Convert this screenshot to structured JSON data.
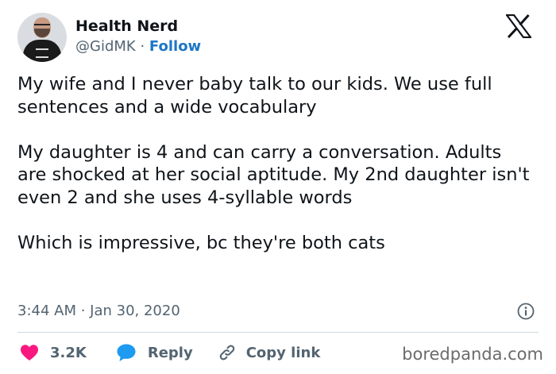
{
  "author": {
    "name": "Health Nerd",
    "handle": "@GidMK",
    "separator": "·",
    "follow_label": "Follow"
  },
  "tweet": {
    "text": "My wife and I never baby talk to our kids. We use full sentences and a wide vocabulary\n\nMy daughter is 4 and can carry a conversation. Adults are shocked at her social aptitude. My 2nd daughter isn't even 2 and she uses 4-syllable words\n\nWhich is impressive, bc they're both cats",
    "time": "3:44 AM · Jan 30, 2020"
  },
  "actions": {
    "like_count": "3.2K",
    "reply_label": "Reply",
    "copy_label": "Copy link"
  },
  "watermark": "boredpanda.com",
  "icons": {
    "logo": "x-logo-icon",
    "info": "info-icon",
    "like": "heart-icon",
    "reply": "chat-bubble-icon",
    "copy": "link-icon"
  },
  "colors": {
    "accent": "#1d76c6",
    "like": "#f91880",
    "reply_icon": "#1d9bf0",
    "muted": "#536471",
    "text": "#0f1419"
  }
}
